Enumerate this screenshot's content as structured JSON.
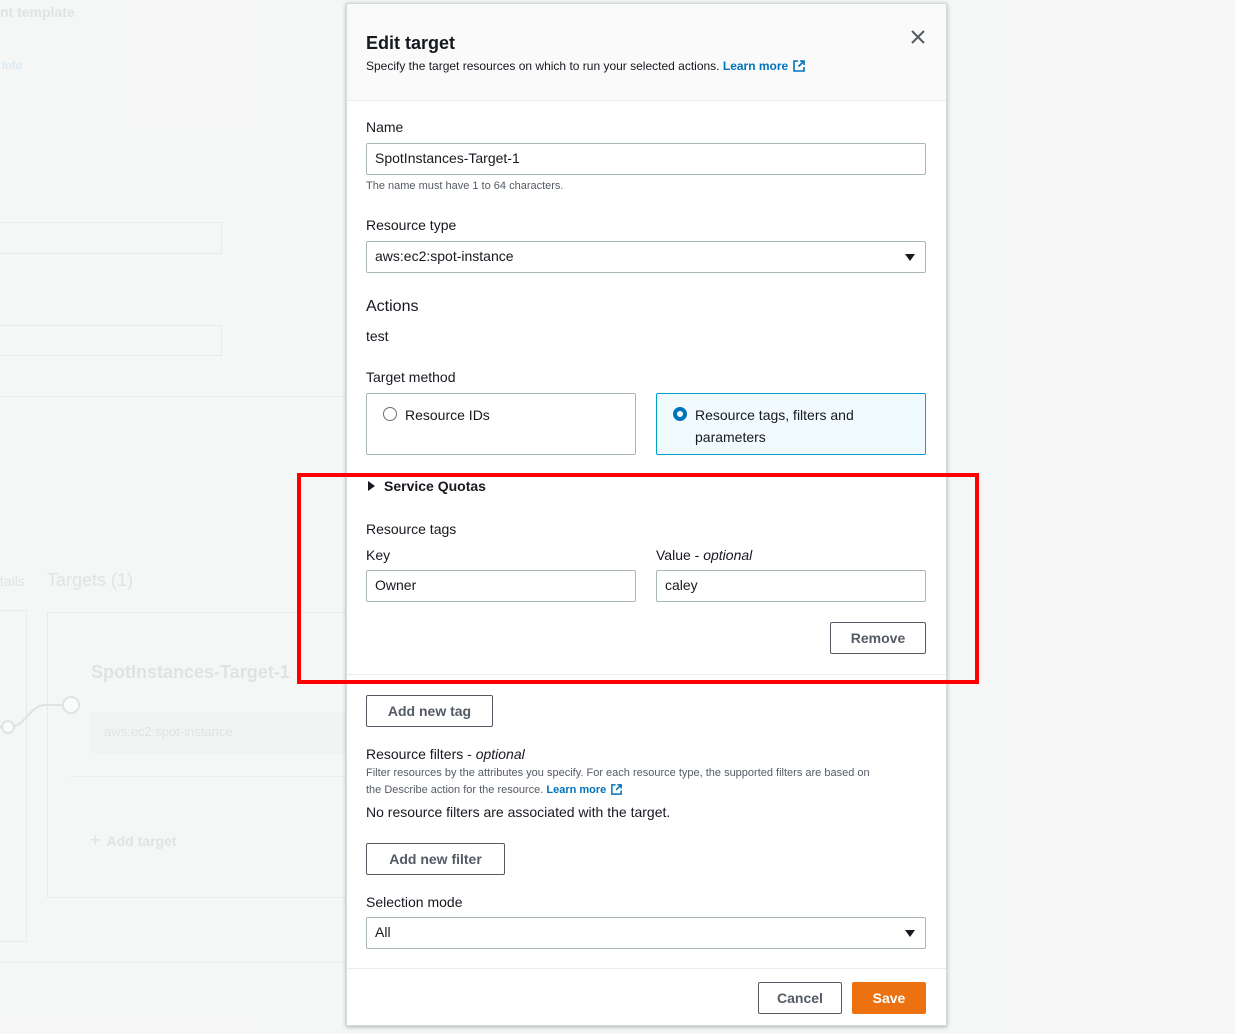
{
  "background": {
    "title_fragment": "nt template",
    "info_fragment": "Info",
    "details_fragment": "tails",
    "targets_tab": "Targets (1)",
    "target_card_name": "SpotInstances-Target-1",
    "target_card_type": "aws:ec2:spot-instance",
    "add_target": "Add target"
  },
  "modal": {
    "title": "Edit target",
    "description": "Specify the target resources on which to run your selected actions.",
    "learn_more": "Learn more",
    "close_icon": "close-icon",
    "name_label": "Name",
    "name_value": "SpotInstances-Target-1",
    "name_hint": "The name must have 1 to 64 characters.",
    "resource_type_label": "Resource type",
    "resource_type_value": "aws:ec2:spot-instance",
    "actions_title": "Actions",
    "actions_value": "test",
    "target_method_label": "Target method",
    "target_method_options": [
      {
        "label": "Resource IDs",
        "selected": false
      },
      {
        "label": "Resource tags, filters and parameters",
        "selected": true
      }
    ],
    "service_quotas": "Service Quotas",
    "resource_tags_label": "Resource tags",
    "key_label": "Key",
    "value_label": "Value - ",
    "value_label_optional": "optional",
    "key_value": "Owner",
    "value_value": "caley",
    "remove_button": "Remove",
    "add_tag_button": "Add new tag",
    "filters_label": "Resource filters - ",
    "filters_label_optional": "optional",
    "filters_desc_line1": "Filter resources by the attributes you specify. For each resource type, the supported filters are based on",
    "filters_desc_line2": "the Describe action for the resource.",
    "filters_learn_more": "Learn more",
    "filters_empty": "No resource filters are associated with the target.",
    "add_filter_button": "Add new filter",
    "selection_mode_label": "Selection mode",
    "selection_mode_value": "All",
    "cancel_button": "Cancel",
    "save_button": "Save"
  },
  "colors": {
    "link": "#0073bb",
    "primary": "#ec7211",
    "highlight": "#ff0000",
    "selected_card_bg": "#f1faff"
  }
}
